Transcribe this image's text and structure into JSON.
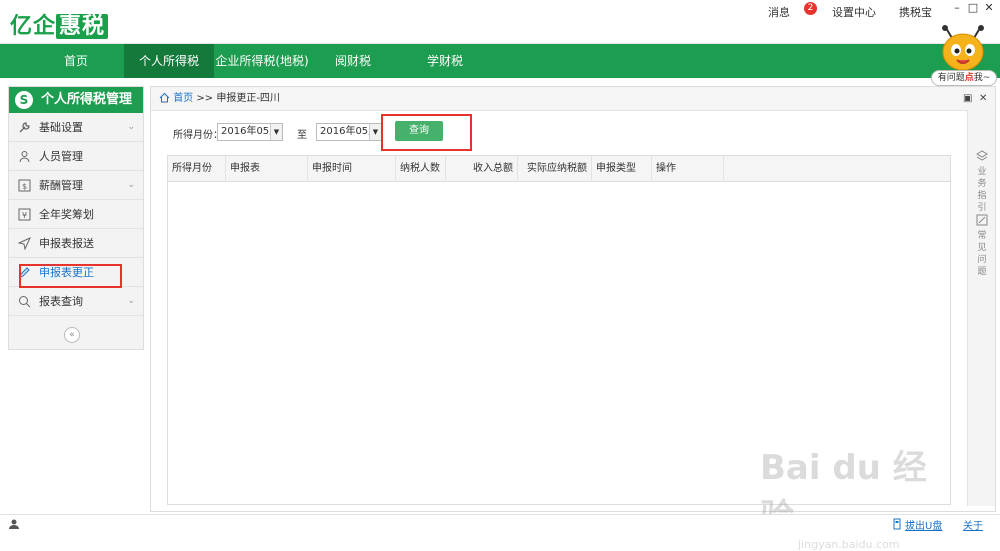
{
  "topbar": {
    "logo_pre": "亿企",
    "logo_hl": "惠税",
    "links": [
      {
        "label": "消息"
      },
      {
        "label": "设置中心"
      },
      {
        "label": "携税宝"
      }
    ],
    "message_badge": "2",
    "window_controls": [
      "–",
      "□",
      "✕"
    ]
  },
  "mainnav": {
    "tabs": [
      {
        "label": "首页",
        "active": false
      },
      {
        "label": "个人所得税",
        "active": true
      },
      {
        "label": "企业所得税(地税)",
        "active": false
      },
      {
        "label": "阅财税",
        "active": false
      },
      {
        "label": "学财税",
        "active": false
      }
    ]
  },
  "help": {
    "bubble_pre": "有问题",
    "bubble_red": "点",
    "bubble_post": "我~"
  },
  "sidebar": {
    "title": "个人所得税管理",
    "coin": "S",
    "items": [
      {
        "label": "基础设置",
        "icon": "wrench-icon",
        "has_chevron": true
      },
      {
        "label": "人员管理",
        "icon": "user-icon",
        "has_chevron": false
      },
      {
        "label": "薪酬管理",
        "icon": "salary-icon",
        "has_chevron": true
      },
      {
        "label": "全年奖筹划",
        "icon": "bonus-icon",
        "has_chevron": false
      },
      {
        "label": "申报表报送",
        "icon": "send-icon",
        "has_chevron": false
      },
      {
        "label": "申报表更正",
        "icon": "pencil-icon",
        "has_chevron": false,
        "active": true
      },
      {
        "label": "报表查询",
        "icon": "search-icon",
        "has_chevron": true
      }
    ],
    "collapse_glyph": "«"
  },
  "content": {
    "breadcrumb_home": "首页",
    "breadcrumb_sep": ">>",
    "breadcrumb_current": "申报更正-四川",
    "filter": {
      "label": "所得月份：",
      "from_value": "2016年05月",
      "to_label": "至",
      "to_value": "2016年05月",
      "query_button": "查询"
    },
    "grid_columns": [
      "所得月份",
      "申报表",
      "申报时间",
      "纳税人数",
      "收入总额",
      "实际应纳税额",
      "申报类型",
      "操作"
    ]
  },
  "rightrail": {
    "items": [
      {
        "label": "业务指引",
        "icon": "layers-icon"
      },
      {
        "label": "常见问题",
        "icon": "edit-icon"
      }
    ]
  },
  "statusbar": {
    "eject_label": "拔出U盘",
    "about_label": "关于"
  },
  "watermark": {
    "brand": "Bai du 经验",
    "url": "jingyan.baidu.com"
  },
  "colors": {
    "brand_green": "#1c9d4f",
    "active_tab": "#137a3b",
    "query_button": "#45b16b",
    "link_blue": "#1a73c8",
    "annotation_red": "#e8322c"
  }
}
